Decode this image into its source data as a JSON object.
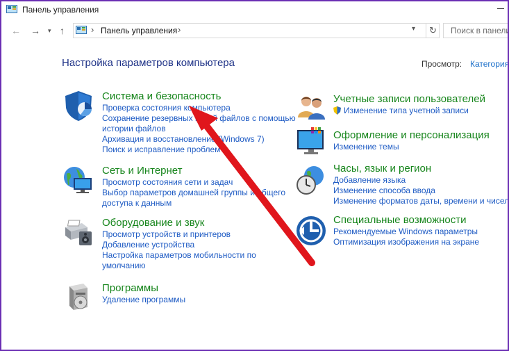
{
  "window": {
    "title": "Панель управления"
  },
  "address": {
    "path": "Панель управления",
    "search_placeholder": "Поиск в панели"
  },
  "page": {
    "heading": "Настройка параметров компьютера",
    "view_label": "Просмотр:",
    "view_value": "Категория"
  },
  "categories": {
    "system": {
      "title": "Система и безопасность",
      "links": [
        "Проверка состояния компьютера",
        "Сохранение резервных копий файлов с помощью",
        "истории файлов",
        "Архивация и восстановление (Windows 7)",
        "Поиск и исправление проблем"
      ]
    },
    "network": {
      "title": "Сеть и Интернет",
      "links": [
        "Просмотр состояния сети и задач",
        "Выбор параметров домашней группы и общего",
        "доступа к данным"
      ]
    },
    "hardware": {
      "title": "Оборудование и звук",
      "links": [
        "Просмотр устройств и принтеров",
        "Добавление устройства",
        "Настройка параметров мобильности по",
        "умолчанию"
      ]
    },
    "programs": {
      "title": "Программы",
      "links": [
        "Удаление программы"
      ]
    },
    "accounts": {
      "title": "Учетные записи пользователей",
      "links": [
        "Изменение типа учетной записи"
      ]
    },
    "appearance": {
      "title": "Оформление и персонализация",
      "links": [
        "Изменение темы"
      ]
    },
    "clock": {
      "title": "Часы, язык и регион",
      "links": [
        "Добавление языка",
        "Изменение способа ввода",
        "Изменение форматов даты, времени и чисел"
      ]
    },
    "access": {
      "title": "Специальные возможности",
      "links": [
        "Рекомендуемые Windows параметры",
        "Оптимизация изображения на экране"
      ]
    }
  },
  "colors": {
    "link": "#1e5bc4",
    "category": "#16851b",
    "heading": "#1e3287",
    "frame": "#6b2fb3",
    "annotation_arrow": "#e0161c"
  }
}
